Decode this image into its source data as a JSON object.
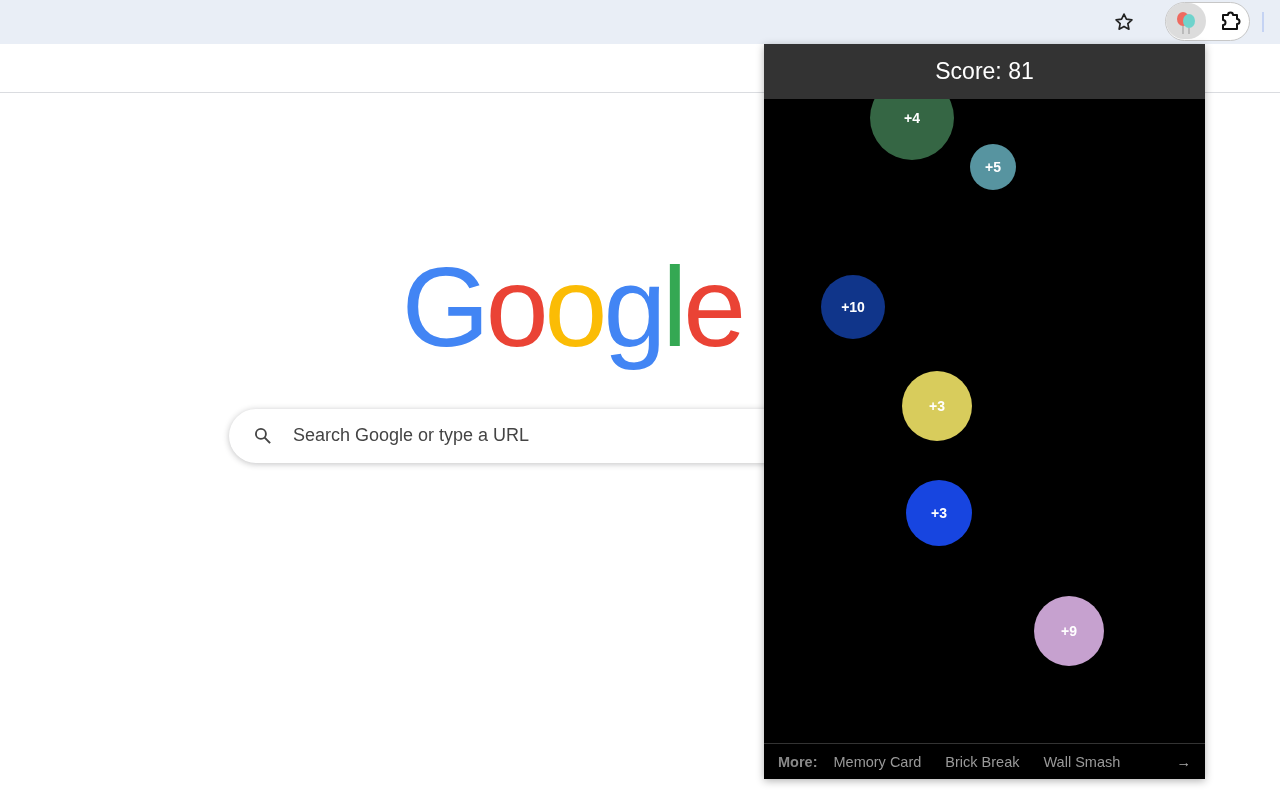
{
  "browser": {
    "logo_letters": [
      {
        "letter": "G",
        "color": "#4285f4"
      },
      {
        "letter": "o",
        "color": "#ea4335"
      },
      {
        "letter": "o",
        "color": "#fbbc05"
      },
      {
        "letter": "g",
        "color": "#4285f4"
      },
      {
        "letter": "l",
        "color": "#34a853"
      },
      {
        "letter": "e",
        "color": "#ea4335"
      }
    ],
    "search": {
      "placeholder": "Search Google or type a URL"
    }
  },
  "popup": {
    "score": "Score: 81",
    "bubbles": [
      {
        "label": "+4",
        "color": "#356644"
      },
      {
        "label": "+5",
        "color": "#5794a0"
      },
      {
        "label": "+10",
        "color": "#10358a"
      },
      {
        "label": "+3",
        "color": "#d8cc5c"
      },
      {
        "label": "+3",
        "color": "#1745e0"
      },
      {
        "label": "+9",
        "color": "#c6a1cf"
      }
    ],
    "footer": {
      "label": "More:",
      "links": [
        "Memory Card",
        "Brick Break",
        "Wall Smash"
      ],
      "arrow": "→"
    }
  }
}
